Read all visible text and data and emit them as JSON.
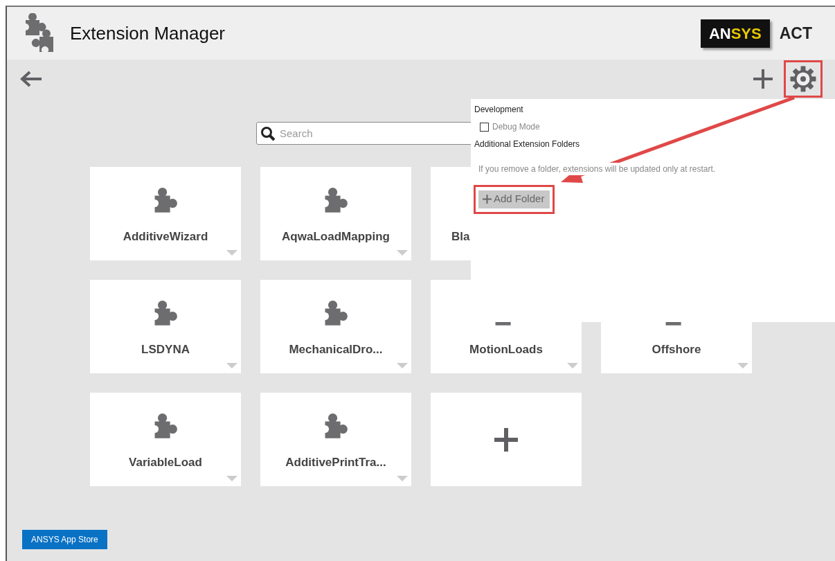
{
  "header": {
    "title": "Extension Manager",
    "brand": "ANSYS",
    "product": "ACT"
  },
  "search": {
    "placeholder": "Search"
  },
  "rows": [
    [
      {
        "kind": "extension",
        "name": "AdditiveWizard"
      },
      {
        "kind": "extension",
        "name": "AqwaLoadMapping"
      },
      {
        "kind": "extension",
        "name": "Bla",
        "partly_hidden": true
      }
    ],
    [
      {
        "kind": "extension",
        "name": "LSDYNA"
      },
      {
        "kind": "extension",
        "name": "MechanicalDro..."
      },
      {
        "kind": "extension",
        "name": "MotionLoads"
      },
      {
        "kind": "extension",
        "name": "Offshore"
      }
    ],
    [
      {
        "kind": "extension",
        "name": "VariableLoad"
      },
      {
        "kind": "extension",
        "name": "AdditivePrintTra..."
      },
      {
        "kind": "add"
      }
    ]
  ],
  "settings_panel": {
    "section": "Development",
    "debug_mode": {
      "label": "Debug Mode",
      "checked": false
    },
    "folders_heading": "Additional Extension Folders",
    "note": "If you remove a folder, extensions will be updated only at restart.",
    "add_button": "Add Folder"
  },
  "footer": {
    "store_button": "ANSYS App Store"
  }
}
